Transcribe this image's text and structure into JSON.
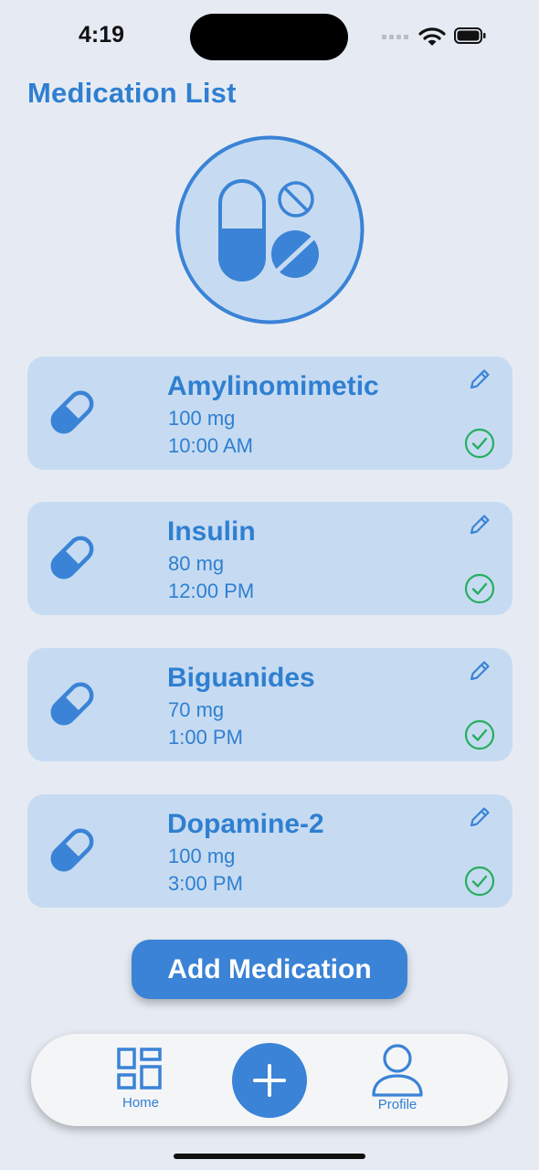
{
  "status_bar": {
    "time": "4:19"
  },
  "header": {
    "title": "Medication List"
  },
  "medications": [
    {
      "name": "Amylinomimetic",
      "dose": "100 mg",
      "time": "10:00 AM"
    },
    {
      "name": "Insulin",
      "dose": "80 mg",
      "time": "12:00 PM"
    },
    {
      "name": "Biguanides",
      "dose": "70 mg",
      "time": "1:00 PM"
    },
    {
      "name": "Dopamine-2",
      "dose": "100 mg",
      "time": "3:00 PM"
    }
  ],
  "actions": {
    "add_label": "Add Medication"
  },
  "tab_bar": {
    "home_label": "Home",
    "profile_label": "Profile"
  },
  "icons": {
    "hero": "pills-icon",
    "card": "pill-icon",
    "edit": "pencil-icon",
    "taken": "check-circle-icon",
    "home": "grid-icon",
    "add": "plus-icon",
    "profile": "person-icon"
  },
  "colors": {
    "accent": "#2f7fd1",
    "card_bg": "#c6dbf2",
    "check": "#27ae60",
    "background": "#e6ebf3"
  }
}
